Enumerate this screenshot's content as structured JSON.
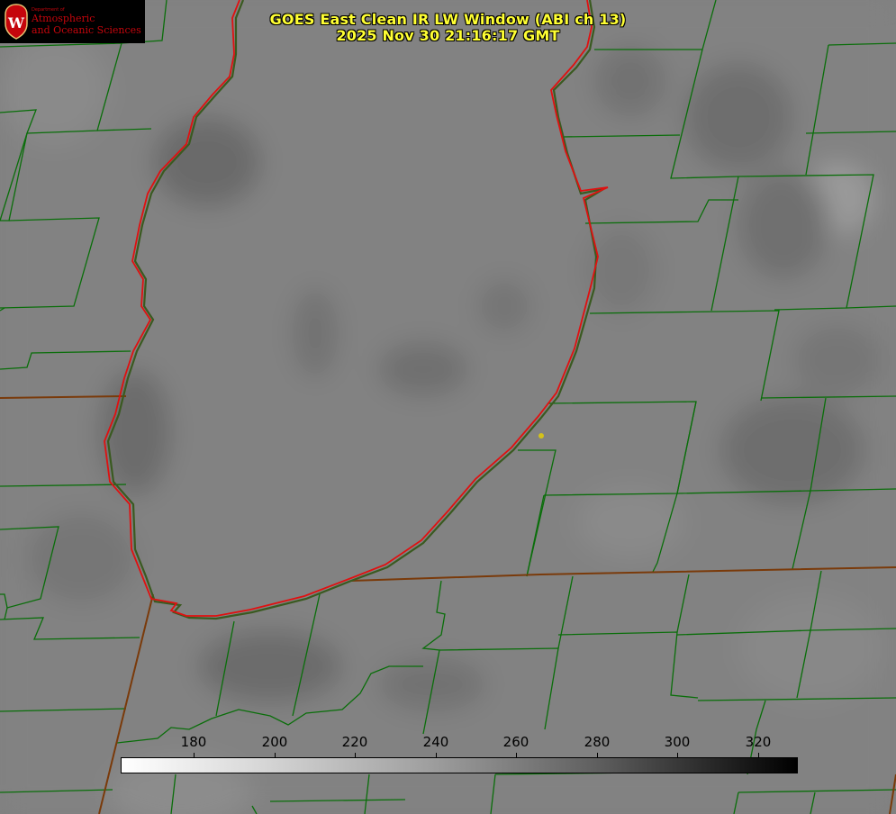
{
  "title": {
    "line1": "GOES East Clean IR LW Window (ABI ch 13)",
    "line2": "2025 Nov 30 21:16:17 GMT"
  },
  "logo": {
    "department": "Department of",
    "line1": "Atmospheric",
    "line2": "and Oceanic Sciences",
    "emblem": "W"
  },
  "colorbar": {
    "ticks": [
      "180",
      "200",
      "220",
      "240",
      "260",
      "280",
      "300",
      "320"
    ],
    "colormap": "greyscale white-to-black"
  },
  "map": {
    "background_color": "#808080",
    "boundary_color": "#0a6e0a",
    "coastline_color": "#e01010",
    "marker_color": "#d4c21a"
  }
}
